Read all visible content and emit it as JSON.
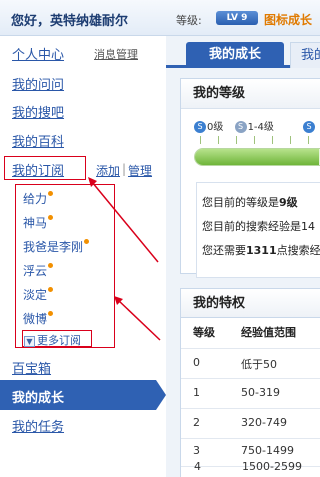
{
  "topbar": {
    "greeting": "您好，英特纳雄耐尔",
    "level_label": "等级:",
    "level_badge": "LV 9",
    "badge_link": "图标成长"
  },
  "sidebar": {
    "personal_center": "个人中心",
    "message_manage": "消息管理",
    "my_questions": "我的问问",
    "my_soba": "我的搜吧",
    "my_baike": "我的百科",
    "my_subscriptions": "我的订阅",
    "add": "添加",
    "separator": "|",
    "manage": "管理",
    "subscriptions": [
      "给力",
      "神马",
      "我爸是李刚",
      "浮云",
      "淡定",
      "微博"
    ],
    "more_subscriptions": "更多订阅",
    "treasure_box": "百宝箱",
    "my_growth": "我的成长",
    "my_tasks": "我的任务"
  },
  "main": {
    "tab_active": "我的成长",
    "tab_other": "我的",
    "level_panel_title": "我的等级",
    "level_range_1": "0级",
    "level_range_2": "1-4级",
    "progress_fraction": 0.9,
    "info_line_1_pre": "您目前的等级是",
    "info_line_1_val": "9级",
    "info_line_2": "您目前的搜索经验是14",
    "info_line_3_pre": "您还需要",
    "info_line_3_val": "1311",
    "info_line_3_post": "点搜索经",
    "privilege_title": "我的特权",
    "table_headers": [
      "等级",
      "经验值范围"
    ],
    "table_rows": [
      [
        "0",
        "低于50"
      ],
      [
        "1",
        "50-319"
      ],
      [
        "2",
        "320-749"
      ],
      [
        "3",
        "750-1499"
      ],
      [
        "4",
        "1500-2599"
      ]
    ]
  },
  "colors": {
    "accent": "#2f61b3",
    "link": "#2a57a8",
    "annotation": "#d9001b",
    "badge_orange": "#e07a00"
  }
}
